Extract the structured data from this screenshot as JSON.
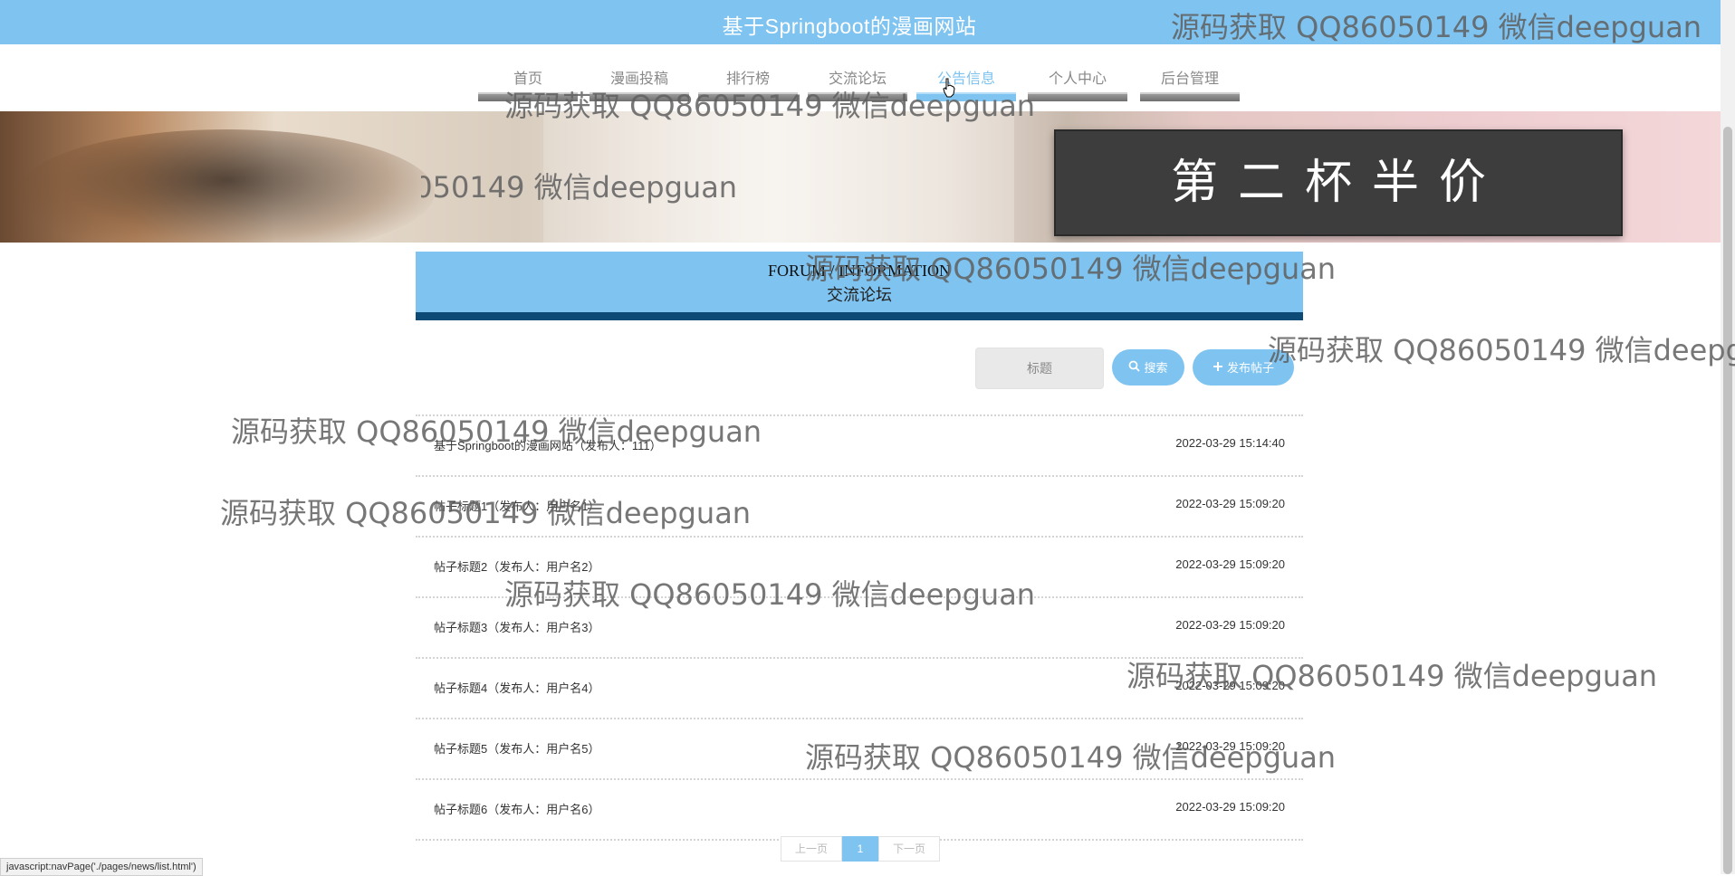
{
  "header": {
    "site_title": "基于Springboot的漫画网站"
  },
  "nav": [
    {
      "label": "首页",
      "active": false
    },
    {
      "label": "漫画投稿",
      "active": false
    },
    {
      "label": "排行榜",
      "active": false
    },
    {
      "label": "交流论坛",
      "active": false
    },
    {
      "label": "公告信息",
      "active": true
    },
    {
      "label": "个人中心",
      "active": false
    },
    {
      "label": "后台管理",
      "active": false
    }
  ],
  "banner": {
    "promo_text": "第二杯半价"
  },
  "section": {
    "title_en": "FORUM / INFORMATION",
    "title_cn": "交流论坛"
  },
  "search": {
    "placeholder": "标题",
    "search_label": "搜索",
    "post_label": "发布帖子"
  },
  "posts": [
    {
      "title": "基于Springboot的漫画网站（发布人：111）",
      "time": "2022-03-29 15:14:40"
    },
    {
      "title": "帖子标题1（发布人：用户名1）",
      "time": "2022-03-29 15:09:20"
    },
    {
      "title": "帖子标题2（发布人：用户名2）",
      "time": "2022-03-29 15:09:20"
    },
    {
      "title": "帖子标题3（发布人：用户名3）",
      "time": "2022-03-29 15:09:20"
    },
    {
      "title": "帖子标题4（发布人：用户名4）",
      "time": "2022-03-29 15:09:20"
    },
    {
      "title": "帖子标题5（发布人：用户名5）",
      "time": "2022-03-29 15:09:20"
    },
    {
      "title": "帖子标题6（发布人：用户名6）",
      "time": "2022-03-29 15:09:20"
    }
  ],
  "pagination": {
    "prev": "上一页",
    "current": "1",
    "next": "下一页"
  },
  "status_url": "javascript:navPage('./pages/news/list.html')",
  "watermark": "源码获取 QQ86050149 微信deepguan",
  "colors": {
    "accent": "#7fc3f0",
    "header_border": "#0e4a76",
    "promo_bg": "#3d3d3d"
  }
}
